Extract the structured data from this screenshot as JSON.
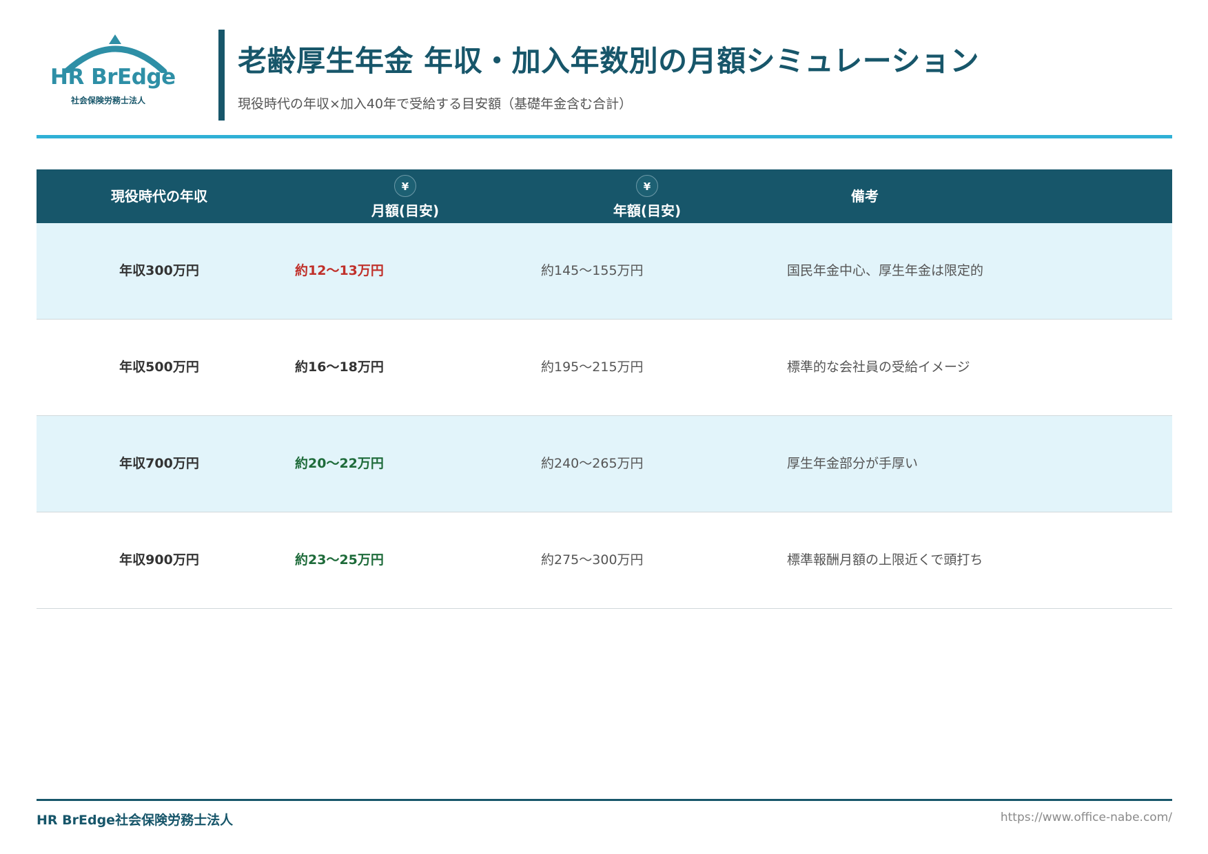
{
  "logo": {
    "name": "HR BrEdge",
    "sub": "社会保険労務士法人"
  },
  "title": "老齢厚生年金 年収・加入年数別の月額シミュレーション",
  "subtitle": "現役時代の年収×加入40年で受給する目安額（基礎年金含む合計）",
  "table": {
    "headers": {
      "income": "現役時代の年収",
      "monthly": "月額(目安)",
      "annual": "年額(目安)",
      "note": "備考",
      "yen_icon": "¥"
    },
    "rows": [
      {
        "income": "年収300万円",
        "monthly": "約12〜13万円",
        "monthly_color": "#c0302a",
        "annual": "約145〜155万円",
        "note": "国民年金中心、厚生年金は限定的"
      },
      {
        "income": "年収500万円",
        "monthly": "約16〜18万円",
        "monthly_color": "#333333",
        "annual": "約195〜215万円",
        "note": "標準的な会社員の受給イメージ"
      },
      {
        "income": "年収700万円",
        "monthly": "約20〜22万円",
        "monthly_color": "#1e6b3a",
        "annual": "約240〜265万円",
        "note": "厚生年金部分が手厚い"
      },
      {
        "income": "年収900万円",
        "monthly": "約23〜25万円",
        "monthly_color": "#1e6b3a",
        "annual": "約275〜300万円",
        "note": "標準報酬月額の上限近くで頭打ち"
      }
    ]
  },
  "footer": {
    "left": "HR BrEdge社会保険労務士法人",
    "right": "https://www.office-nabe.com/"
  },
  "colors": {
    "primary": "#17566a",
    "accent": "#2fb0d6",
    "row_shade": "#e2f4fa"
  }
}
